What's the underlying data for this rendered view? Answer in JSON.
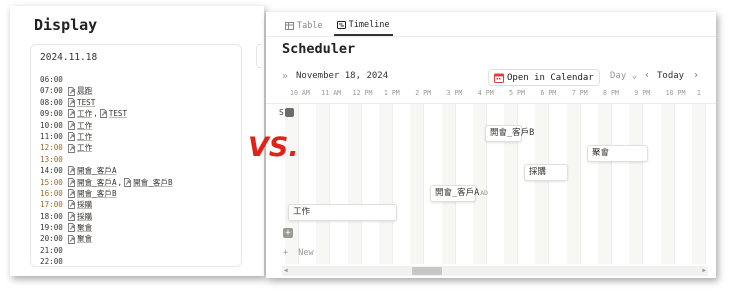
{
  "left": {
    "title": "Display",
    "date": "2024.11.18",
    "hours": [
      {
        "time": "06:00",
        "highlight": false,
        "entries": []
      },
      {
        "time": "07:00",
        "highlight": false,
        "entries": [
          "晨跑"
        ]
      },
      {
        "time": "08:00",
        "highlight": false,
        "entries": [
          "TEST"
        ]
      },
      {
        "time": "09:00",
        "highlight": false,
        "entries": [
          "工作",
          "TEST"
        ]
      },
      {
        "time": "10:00",
        "highlight": false,
        "entries": [
          "工作"
        ]
      },
      {
        "time": "11:00",
        "highlight": false,
        "entries": [
          "工作"
        ]
      },
      {
        "time": "12:00",
        "highlight": true,
        "entries": [
          "工作"
        ]
      },
      {
        "time": "13:00",
        "highlight": true,
        "entries": []
      },
      {
        "time": "14:00",
        "highlight": false,
        "entries": [
          "開會_客戶A"
        ]
      },
      {
        "time": "15:00",
        "highlight": true,
        "entries": [
          "開會_客戶A",
          "開會_客戶B"
        ]
      },
      {
        "time": "16:00",
        "highlight": true,
        "entries": [
          "開會_客戶B"
        ]
      },
      {
        "time": "17:00",
        "highlight": true,
        "entries": [
          "採購"
        ]
      },
      {
        "time": "18:00",
        "highlight": false,
        "entries": [
          "採購"
        ]
      },
      {
        "time": "19:00",
        "highlight": false,
        "entries": [
          "聚會"
        ]
      },
      {
        "time": "20:00",
        "highlight": false,
        "entries": [
          "聚會"
        ]
      },
      {
        "time": "21:00",
        "highlight": false,
        "entries": []
      },
      {
        "time": "22:00",
        "highlight": false,
        "entries": []
      }
    ]
  },
  "vs_label": "VS.",
  "right": {
    "tabs": [
      {
        "label": "Table",
        "icon": "table-icon",
        "active": false
      },
      {
        "label": "Timeline",
        "icon": "timeline-icon",
        "active": true
      }
    ],
    "title": "Scheduler",
    "toolbar": {
      "collapse_icon": "»",
      "date": "November 18, 2024",
      "open_calendar": "Open in Calendar",
      "view": "Day",
      "view_chevron": "⌄",
      "prev": "‹",
      "today": "Today",
      "next": "›"
    },
    "hour_labels": [
      "10 AM",
      "11 AM",
      "12 PM",
      "1 PM",
      "2 PM",
      "3 PM",
      "4 PM",
      "5 PM",
      "6 PM",
      "7 PM",
      "8 PM",
      "9 PM",
      "10 PM",
      "1"
    ],
    "row_label": "S",
    "new_label": "New",
    "add_icon": "+",
    "events": [
      {
        "label": "工作",
        "ext": ""
      },
      {
        "label": "開會_客戶A",
        "ext": "AD"
      },
      {
        "label": "開會_客戶B",
        "ext": ""
      },
      {
        "label": "採購",
        "ext": ""
      },
      {
        "label": "聚會",
        "ext": ""
      }
    ],
    "colors": {
      "accent": "#37352f",
      "vs_red": "#e0221b",
      "calendar_red": "#e03e3e",
      "time_highlight": "#9a6a2c"
    }
  }
}
